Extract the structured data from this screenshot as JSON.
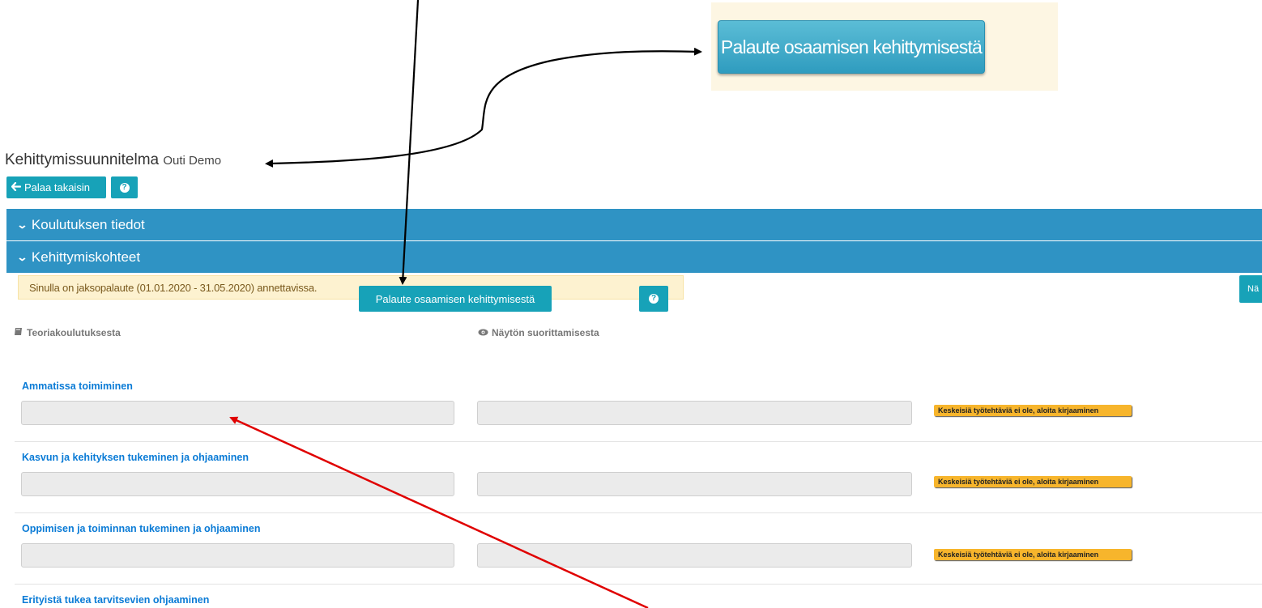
{
  "callout": {
    "button_label": "Palaute osaamisen kehittymisestä"
  },
  "header": {
    "title": "Kehittymissuunnitelma",
    "user": "Outi Demo",
    "back_label": "Palaa takaisin",
    "help_label": "?"
  },
  "panels": {
    "koulutus": "Koulutuksen tiedot",
    "kehittymis": "Kehittymiskohteet"
  },
  "alert": {
    "text": "Sinulla on jaksopalaute (01.01.2020 - 31.05.2020) annettavissa.",
    "button_label": "Palaute osaamisen kehittymisestä",
    "help_label": "?",
    "edge_button_label": "Nä"
  },
  "columns": {
    "theory": "Teoriakoulutuksesta",
    "demo": "Näytön suorittamisesta"
  },
  "sections": [
    {
      "title": "Ammatissa toimiminen",
      "badge": "Keskeisiä työtehtäviä ei ole, aloita kirjaaminen"
    },
    {
      "title": "Kasvun ja kehityksen tukeminen ja ohjaaminen",
      "badge": "Keskeisiä työtehtäviä ei ole, aloita kirjaaminen"
    },
    {
      "title": "Oppimisen ja toiminnan tukeminen ja ohjaaminen",
      "badge": "Keskeisiä työtehtäviä ei ole, aloita kirjaaminen"
    },
    {
      "title": "Erityistä tukea tarvitsevien ohjaaminen"
    }
  ],
  "colors": {
    "panel": "#2f93c4",
    "button": "#17a2b8",
    "link": "#0a7bd6",
    "badge": "#f7b52c",
    "arrow_annotation": "#e00000"
  }
}
